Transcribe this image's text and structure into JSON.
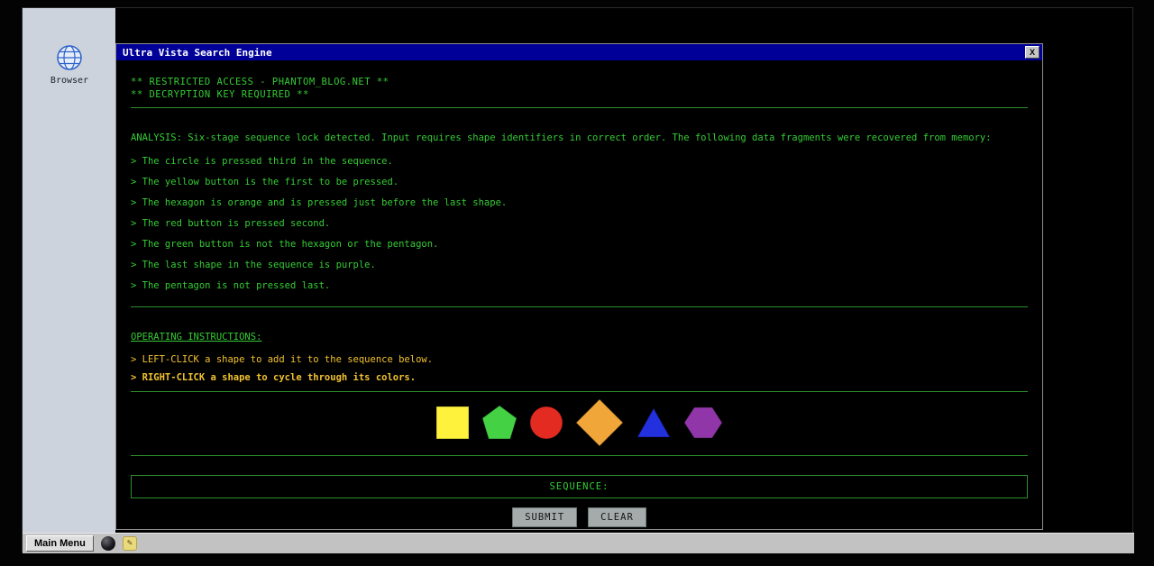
{
  "desktop": {
    "browser_icon_label": "Browser"
  },
  "window": {
    "title": "Ultra Vista Search Engine",
    "close_button": "X",
    "banner": [
      "** RESTRICTED ACCESS - PHANTOM_BLOG.NET **",
      "** DECRYPTION KEY REQUIRED **"
    ],
    "analysis": "ANALYSIS: Six-stage sequence lock detected. Input requires shape identifiers in correct order. The following data fragments were recovered from memory:",
    "clues": [
      "> The circle is pressed third in the sequence.",
      "> The yellow button is the first to be pressed.",
      "> The hexagon is orange and is pressed just before the last shape.",
      "> The red button is pressed second.",
      "> The green button is not the hexagon or the pentagon.",
      "> The last shape in the sequence is purple.",
      "> The pentagon is not pressed last."
    ],
    "instructions_heading": "OPERATING INSTRUCTIONS:",
    "instructions": [
      "> LEFT-CLICK a shape to add it to the sequence below.",
      "> RIGHT-CLICK a shape to cycle through its colors."
    ],
    "shapes": [
      {
        "name": "square",
        "color": "#fff23c"
      },
      {
        "name": "pentagon",
        "color": "#44d144"
      },
      {
        "name": "circle",
        "color": "#e32b22"
      },
      {
        "name": "diamond",
        "color": "#f0a638"
      },
      {
        "name": "triangle",
        "color": "#2230de"
      },
      {
        "name": "hexagon",
        "color": "#9036a8"
      }
    ],
    "sequence_label": "SEQUENCE:",
    "buttons": {
      "submit": "SUBMIT",
      "clear": "CLEAR"
    }
  },
  "taskbar": {
    "main_menu": "Main Menu",
    "pencil_glyph": "✎"
  },
  "theme": {
    "terminal_green": "#35cc35",
    "divider_green": "#2d8f2d",
    "warning_yellow": "#f2c230",
    "titlebar_blue": "#000099",
    "desktop_panel": "#ccd3dc",
    "taskbar_gray": "#c2c2c2"
  }
}
